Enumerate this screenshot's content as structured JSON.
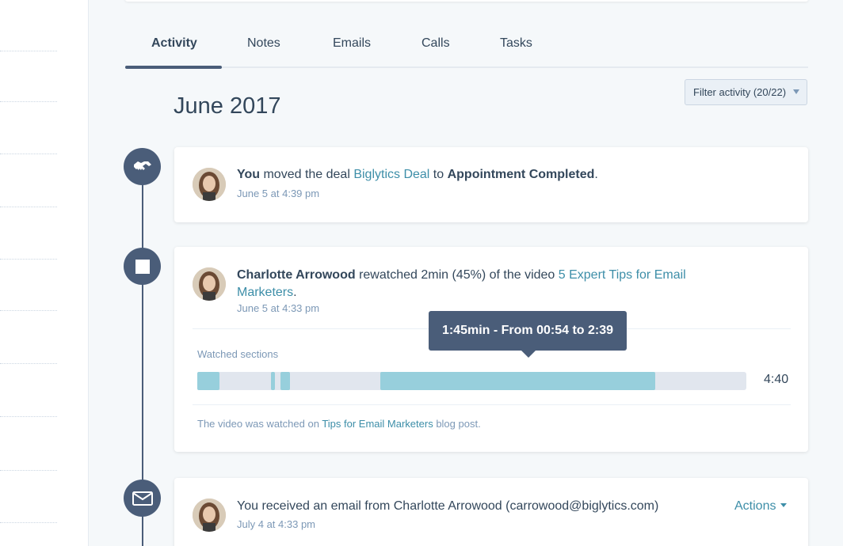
{
  "tabs": [
    {
      "label": "Activity",
      "active": true
    },
    {
      "label": "Notes"
    },
    {
      "label": "Emails"
    },
    {
      "label": "Calls"
    },
    {
      "label": "Tasks"
    }
  ],
  "filter": {
    "label": "Filter activity (20/22)"
  },
  "month": "June 2017",
  "activities": [
    {
      "icon": "handshake-icon",
      "actor": "You",
      "verb": " moved the deal ",
      "deal": "Biglytics Deal",
      "to": " to ",
      "stage": "Appointment Completed",
      "end": ".",
      "timestamp": "June 5 at 4:39 pm"
    },
    {
      "icon": "stop-icon",
      "actor": "Charlotte Arrowood",
      "verb": " rewatched 2min (45%) of the video ",
      "video_line1": "5 Expert Tips for Email",
      "video_line2": "Marketers",
      "end": ".",
      "timestamp": "June 5 at 4:33 pm",
      "tooltip": "1:45min - From 00:54 to 2:39",
      "watched_label": "Watched sections",
      "total_duration": "4:40",
      "note_prefix": "The video was watched on ",
      "note_link": "Tips for Email Marketers",
      "note_suffix": " blog post.",
      "watched_fraction": 0.45
    },
    {
      "icon": "envelope-icon",
      "text": "You received an email from Charlotte Arrowood (carrowood@biglytics.com)",
      "timestamp": "July 4 at 4:33 pm",
      "actions_label": "Actions"
    }
  ],
  "colors": {
    "accent": "#4a5d79",
    "link": "#3d8ea8",
    "watched": "#97cfdc"
  }
}
